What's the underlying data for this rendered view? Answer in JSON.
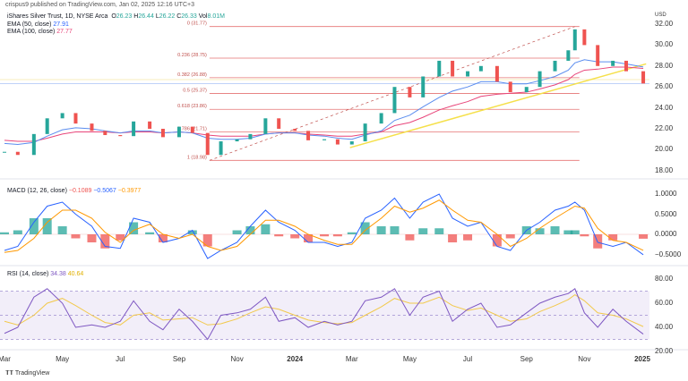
{
  "header": {
    "published": "crispus9 published on TradingView.com, Jan 02, 2025 12:16 UTC+3",
    "symbol": "iShares Silver Trust, 1D, NYSE Arca",
    "o_label": "O",
    "o": "26.23",
    "h_label": "H",
    "h": "26.44",
    "l_label": "L",
    "l": "26.22",
    "c_label": "C",
    "c": "26.33",
    "vol_label": "Vol",
    "vol": "8.01M",
    "ema50_label": "EMA (50, close)",
    "ema50": "27.91",
    "ema100_label": "EMA (100, close)",
    "ema100": "27.77"
  },
  "macd_legend": {
    "label": "MACD (12, 26, close)",
    "hist": "−0.1089",
    "macd": "−0.5067",
    "signal": "−0.3977"
  },
  "rsi_legend": {
    "label": "RSI (14, close)",
    "rsi": "34.38",
    "ma": "40.64"
  },
  "footer": {
    "logo": "TradingView"
  },
  "colors": {
    "up": "#26a69a",
    "down": "#ef5350",
    "ema50": "#5b8def",
    "ema100": "#e8457a",
    "fib": "#e57373",
    "trend": "#f5e04a",
    "macd": "#2962ff",
    "signal": "#ff9800",
    "rsi": "#7e57c2",
    "rsi_ma": "#f2c94c",
    "rsi_band": "#ede7f6"
  },
  "chart_data": {
    "type": "candlestick",
    "currency": "USD",
    "price_axis": {
      "ticks": [
        "32.00",
        "30.00",
        "28.00",
        "26.00",
        "24.00",
        "22.00",
        "20.00",
        "18.00"
      ],
      "range": [
        17.5,
        33
      ]
    },
    "macd_axis": {
      "ticks": [
        "1.0000",
        "0.5000",
        "0.0000",
        "−0.5000"
      ],
      "range": [
        -0.7,
        1.2
      ]
    },
    "rsi_axis": {
      "ticks": [
        "80.00",
        "60.00",
        "40.00",
        "20.00"
      ],
      "range": [
        18,
        85
      ],
      "bands": [
        30,
        50,
        70
      ]
    },
    "x_ticks": [
      {
        "label": "Mar",
        "date": "2023-03-01"
      },
      {
        "label": "May",
        "date": "2023-05-01"
      },
      {
        "label": "Jul",
        "date": "2023-07-01"
      },
      {
        "label": "Sep",
        "date": "2023-09-01"
      },
      {
        "label": "Nov",
        "date": "2023-11-01"
      },
      {
        "label": "2024",
        "date": "2024-01-01",
        "bold": true
      },
      {
        "label": "Mar",
        "date": "2024-03-01"
      },
      {
        "label": "May",
        "date": "2024-05-01"
      },
      {
        "label": "Jul",
        "date": "2024-07-01"
      },
      {
        "label": "Sep",
        "date": "2024-09-01"
      },
      {
        "label": "Nov",
        "date": "2024-11-01"
      },
      {
        "label": "2025",
        "date": "2025-01-01",
        "bold": true
      }
    ],
    "dates": [
      "2023-03-01",
      "2023-03-15",
      "2023-04-01",
      "2023-04-15",
      "2023-05-01",
      "2023-05-15",
      "2023-06-01",
      "2023-06-15",
      "2023-07-01",
      "2023-07-15",
      "2023-08-01",
      "2023-08-15",
      "2023-09-01",
      "2023-09-15",
      "2023-10-01",
      "2023-10-15",
      "2023-11-01",
      "2023-11-15",
      "2023-12-01",
      "2023-12-15",
      "2024-01-01",
      "2024-01-15",
      "2024-02-01",
      "2024-02-15",
      "2024-03-01",
      "2024-03-15",
      "2024-04-01",
      "2024-04-15",
      "2024-05-01",
      "2024-05-15",
      "2024-06-01",
      "2024-06-15",
      "2024-07-01",
      "2024-07-15",
      "2024-08-01",
      "2024-08-15",
      "2024-09-01",
      "2024-09-15",
      "2024-10-01",
      "2024-10-15",
      "2024-10-22",
      "2024-11-01",
      "2024-11-15",
      "2024-12-01",
      "2024-12-15",
      "2025-01-02"
    ],
    "close": [
      19.8,
      19.5,
      21.5,
      23.0,
      23.5,
      22.5,
      21.8,
      21.4,
      21.3,
      22.7,
      22.0,
      21.2,
      22.2,
      21.6,
      19.5,
      20.8,
      21.0,
      21.5,
      23.0,
      22.0,
      21.8,
      20.9,
      21.0,
      20.5,
      20.8,
      22.5,
      23.5,
      26.0,
      25.0,
      27.0,
      28.5,
      27.0,
      27.5,
      28.0,
      26.5,
      25.5,
      26.0,
      27.5,
      28.5,
      29.5,
      31.5,
      30.0,
      28.0,
      28.5,
      27.5,
      26.33
    ],
    "ema50": [
      20.6,
      20.5,
      20.7,
      21.3,
      21.9,
      22.1,
      22.0,
      21.8,
      21.6,
      21.8,
      21.8,
      21.6,
      21.7,
      21.6,
      21.1,
      21.0,
      21.0,
      21.1,
      21.5,
      21.6,
      21.6,
      21.4,
      21.3,
      21.1,
      21.0,
      21.4,
      21.8,
      22.8,
      23.3,
      24.1,
      25.0,
      25.6,
      26.0,
      26.5,
      26.5,
      26.3,
      26.3,
      26.6,
      27.0,
      27.6,
      28.3,
      28.6,
      28.4,
      28.4,
      28.2,
      27.91
    ],
    "ema100": [
      20.9,
      20.8,
      20.8,
      21.1,
      21.5,
      21.7,
      21.7,
      21.7,
      21.6,
      21.7,
      21.7,
      21.6,
      21.7,
      21.6,
      21.4,
      21.3,
      21.3,
      21.3,
      21.5,
      21.6,
      21.6,
      21.5,
      21.4,
      21.3,
      21.3,
      21.5,
      21.7,
      22.3,
      22.6,
      23.1,
      23.8,
      24.2,
      24.6,
      25.1,
      25.3,
      25.4,
      25.5,
      25.8,
      26.2,
      26.7,
      27.2,
      27.6,
      27.7,
      27.9,
      27.9,
      27.77
    ],
    "fib": {
      "levels": [
        {
          "ratio": "0",
          "price": 31.77,
          "label": "0 (31.77)"
        },
        {
          "ratio": "0.236",
          "price": 28.75,
          "label": "0.236 (28.75)"
        },
        {
          "ratio": "0.382",
          "price": 26.88,
          "label": "0.382 (26.88)"
        },
        {
          "ratio": "0.5",
          "price": 25.37,
          "label": "0.5 (25.37)"
        },
        {
          "ratio": "0.618",
          "price": 23.86,
          "label": "0.618 (23.86)"
        },
        {
          "ratio": "0.786",
          "price": 21.71,
          "label": "0.786 (21.71)"
        },
        {
          "ratio": "1",
          "price": 18.98,
          "label": "1 (18.98)"
        }
      ],
      "from": {
        "date": "2023-10-03",
        "price": 18.98
      },
      "to": {
        "date": "2024-10-22",
        "price": 31.77
      }
    },
    "trendline": {
      "from": {
        "date": "2024-02-28",
        "price": 20.2
      },
      "to": {
        "date": "2025-01-05",
        "price": 28.2
      }
    },
    "macd": [
      -0.4,
      -0.3,
      0.3,
      0.7,
      0.8,
      0.5,
      0.2,
      -0.3,
      -0.35,
      0.4,
      0.3,
      -0.2,
      -0.1,
      0.1,
      -0.6,
      -0.4,
      -0.2,
      0.2,
      0.6,
      0.3,
      0.1,
      -0.2,
      -0.2,
      -0.3,
      -0.2,
      0.4,
      0.6,
      0.9,
      0.4,
      0.8,
      1.0,
      0.4,
      0.2,
      0.3,
      -0.3,
      -0.4,
      0.1,
      0.3,
      0.6,
      0.7,
      0.8,
      0.6,
      -0.2,
      -0.3,
      -0.2,
      -0.5067
    ],
    "signal": [
      -0.45,
      -0.4,
      -0.1,
      0.3,
      0.6,
      0.6,
      0.4,
      0.05,
      -0.2,
      0.1,
      0.25,
      0.0,
      -0.1,
      0.0,
      -0.3,
      -0.4,
      -0.3,
      0.0,
      0.35,
      0.35,
      0.2,
      0.0,
      -0.15,
      -0.25,
      -0.25,
      0.1,
      0.4,
      0.7,
      0.55,
      0.65,
      0.85,
      0.6,
      0.35,
      0.3,
      0.0,
      -0.3,
      -0.1,
      0.15,
      0.4,
      0.6,
      0.7,
      0.65,
      0.15,
      -0.15,
      -0.2,
      -0.3977
    ],
    "rsi": [
      35,
      40,
      65,
      72,
      60,
      40,
      42,
      40,
      45,
      62,
      45,
      38,
      55,
      45,
      30,
      50,
      52,
      55,
      65,
      45,
      48,
      40,
      45,
      42,
      45,
      62,
      65,
      72,
      50,
      65,
      70,
      45,
      55,
      60,
      40,
      42,
      52,
      60,
      65,
      68,
      72,
      52,
      40,
      55,
      45,
      34.38
    ],
    "rsi_ma": [
      45,
      42,
      50,
      60,
      64,
      58,
      50,
      44,
      42,
      50,
      52,
      46,
      47,
      48,
      42,
      43,
      47,
      52,
      57,
      55,
      50,
      46,
      44,
      43,
      44,
      50,
      57,
      64,
      60,
      60,
      65,
      58,
      54,
      56,
      50,
      45,
      47,
      53,
      58,
      63,
      67,
      62,
      52,
      50,
      47,
      40.64
    ]
  }
}
